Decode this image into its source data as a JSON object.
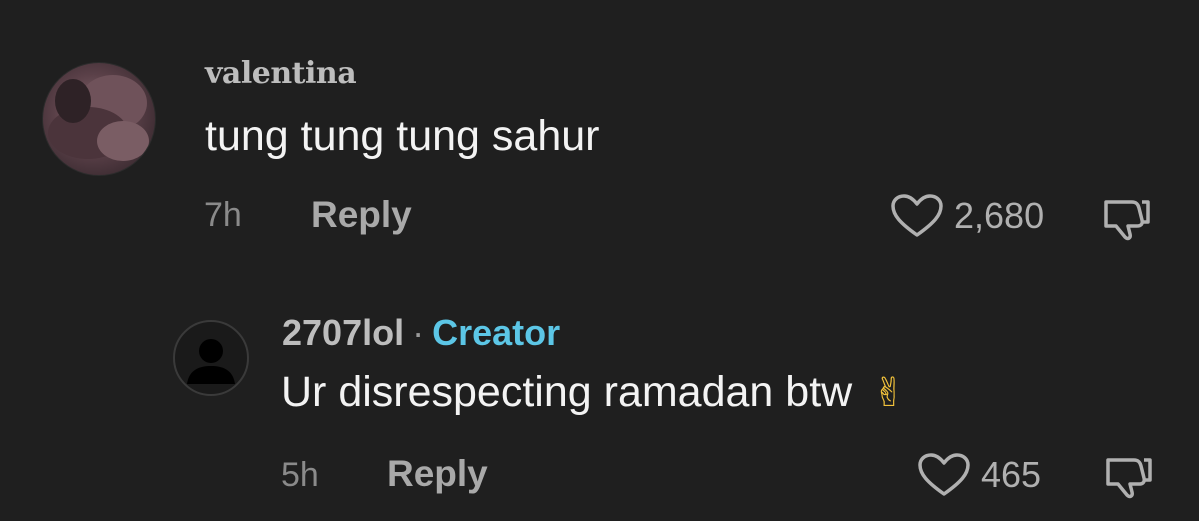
{
  "comments": [
    {
      "username": "valentina",
      "text": "tung tung tung sahur",
      "time": "7h",
      "reply_label": "Reply",
      "likes": "2,680"
    }
  ],
  "replies": [
    {
      "username": "2707lol",
      "separator": "·",
      "badge": "Creator",
      "text": "Ur disrespecting ramadan btw",
      "emoji": "✌",
      "time": "5h",
      "reply_label": "Reply",
      "likes": "465"
    }
  ],
  "colors": {
    "background": "#1f1f1f",
    "creator_badge": "#5cc6e6",
    "text_primary": "#f3f3f3",
    "text_secondary": "#8a8a8a"
  },
  "icons": [
    "heart-icon",
    "dislike-icon",
    "victory-hand-emoji"
  ]
}
